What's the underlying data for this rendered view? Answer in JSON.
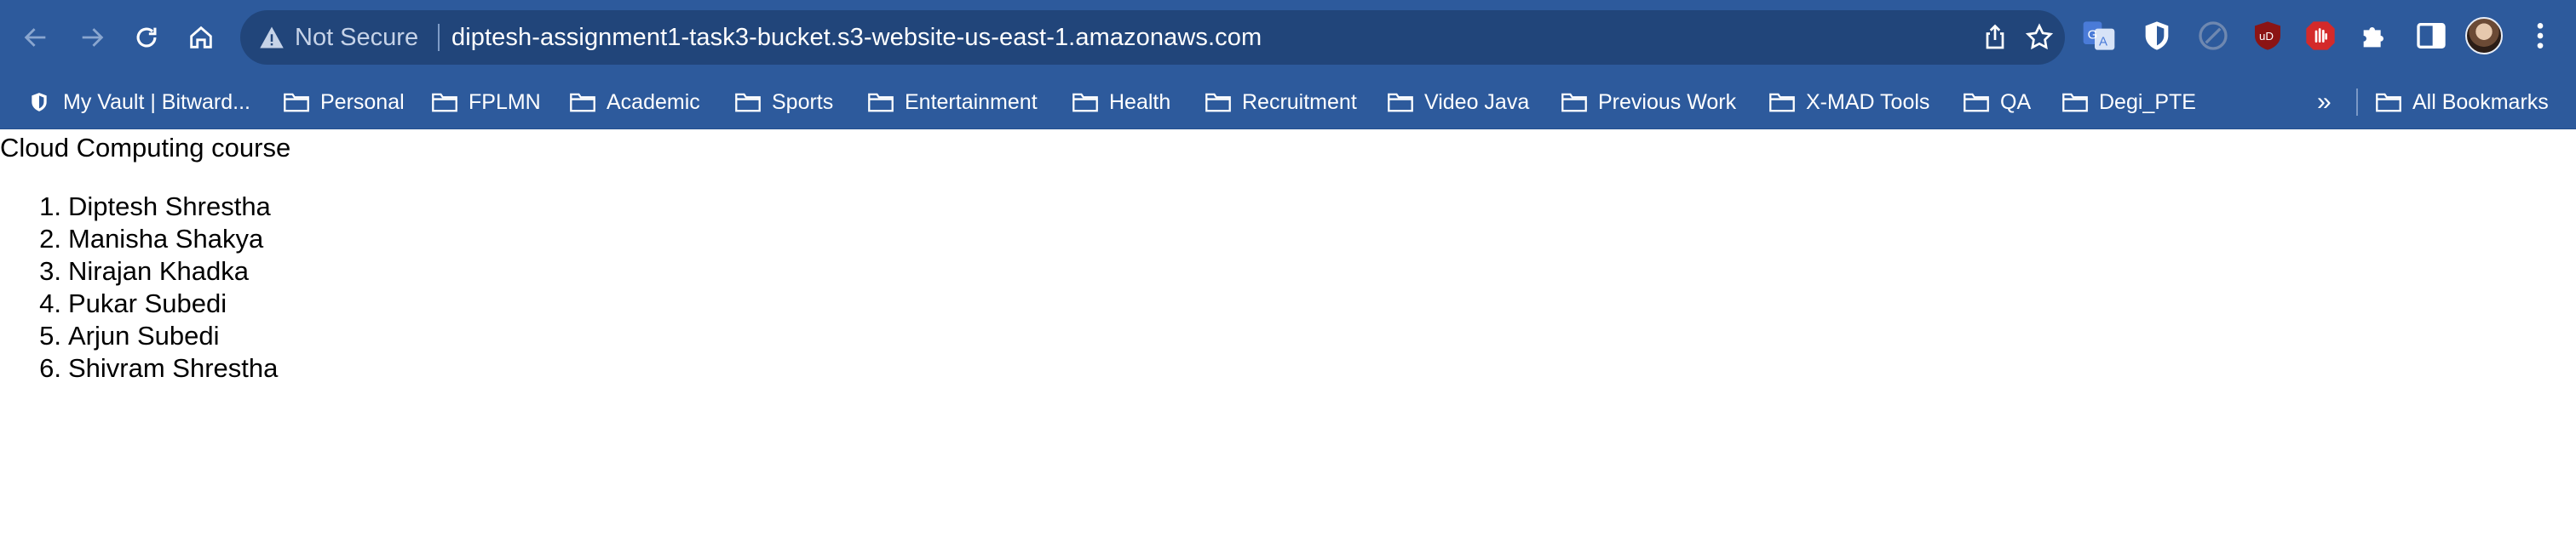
{
  "browser": {
    "security_status": "Not Secure",
    "url": "diptesh-assignment1-task3-bucket.s3-website-us-east-1.amazonaws.com",
    "colors": {
      "toolbar": "#2d5a9c",
      "omnibox": "#21457a"
    }
  },
  "bookmarks": {
    "items": [
      {
        "label": "My Vault | Bitward...",
        "icon": "bitwarden-shield-icon"
      },
      {
        "label": "Personal",
        "icon": "folder-icon"
      },
      {
        "label": "FPLMN",
        "icon": "folder-icon"
      },
      {
        "label": "Academic",
        "icon": "folder-icon"
      },
      {
        "label": "Sports",
        "icon": "folder-icon"
      },
      {
        "label": "Entertainment",
        "icon": "folder-icon"
      },
      {
        "label": "Health",
        "icon": "folder-icon"
      },
      {
        "label": "Recruitment",
        "icon": "folder-icon"
      },
      {
        "label": "Video Java",
        "icon": "folder-icon"
      },
      {
        "label": "Previous Work",
        "icon": "folder-icon"
      },
      {
        "label": "X-MAD Tools",
        "icon": "folder-icon"
      },
      {
        "label": "QA",
        "icon": "folder-icon"
      },
      {
        "label": "Degi_PTE",
        "icon": "folder-icon"
      }
    ],
    "overflow": "»",
    "all_bookmarks": "All Bookmarks"
  },
  "page": {
    "heading": "Cloud Computing course",
    "members": [
      {
        "num": "1.",
        "name": "Diptesh Shrestha"
      },
      {
        "num": "2.",
        "name": "Manisha Shakya"
      },
      {
        "num": "3.",
        "name": "Nirajan Khadka"
      },
      {
        "num": "4.",
        "name": "Pukar Subedi"
      },
      {
        "num": "5.",
        "name": "Arjun Subedi"
      },
      {
        "num": "6.",
        "name": "Shivram Shrestha"
      }
    ]
  }
}
